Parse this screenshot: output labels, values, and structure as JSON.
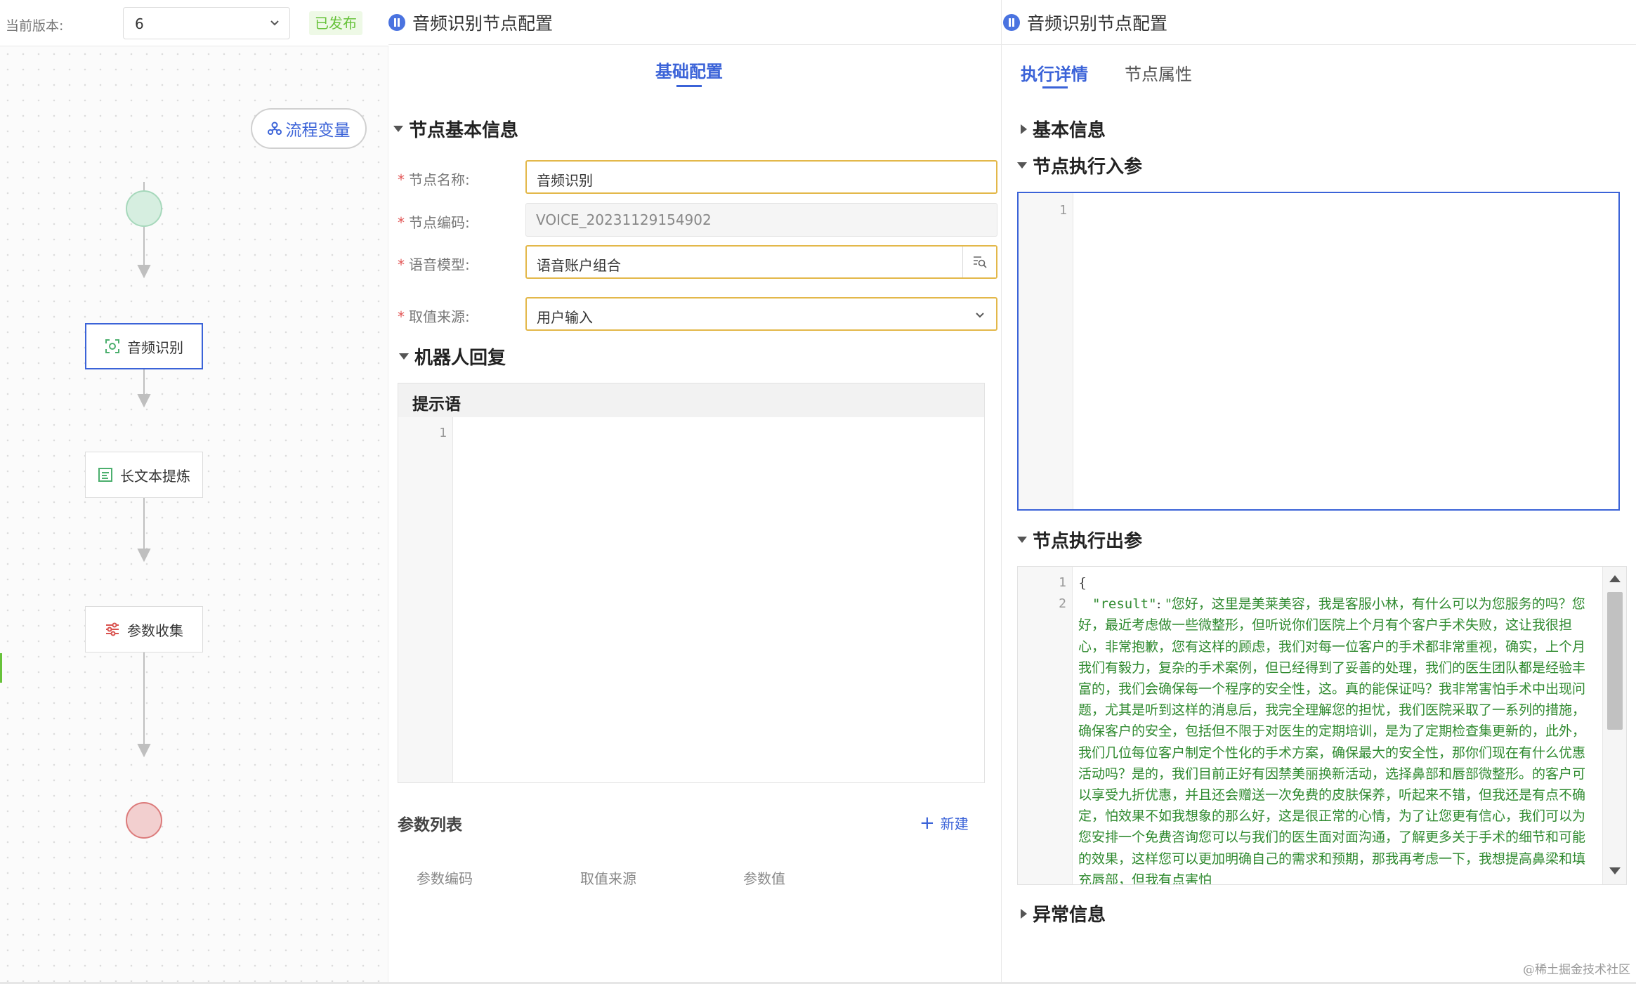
{
  "version_bar": {
    "label": "当前版本:",
    "selected_version": "6",
    "status_badge": "已发布"
  },
  "flow": {
    "flow_variables_button": "流程变量",
    "nodes": {
      "audio_recognition": "音频识别",
      "long_text_extraction": "长文本提炼",
      "parameter_collection": "参数收集"
    }
  },
  "config_panel": {
    "title": "音频识别节点配置",
    "tab": "基础配置",
    "section_basic": "节点基本信息",
    "fields": {
      "node_name": {
        "label": "节点名称:",
        "value": "音频识别"
      },
      "node_code": {
        "label": "节点编码:",
        "value": "VOICE_20231129154902"
      },
      "voice_model": {
        "label": "语音模型:",
        "value": "语音账户组合"
      },
      "value_source": {
        "label": "取值来源:",
        "value": "用户输入"
      }
    },
    "section_robot_reply": "机器人回复",
    "prompt": {
      "title": "提示语",
      "line_number": "1"
    },
    "param_list": {
      "title": "参数列表",
      "new_button": "新建",
      "columns": [
        "参数编码",
        "取值来源",
        "参数值"
      ]
    }
  },
  "exec_panel": {
    "title": "音频识别节点配置",
    "tabs": {
      "exec_detail": "执行详情",
      "node_props": "节点属性"
    },
    "sections": {
      "basic_info": "基本信息",
      "exec_input": "节点执行入参",
      "exec_output": "节点执行出参",
      "error_info": "异常信息"
    },
    "input_editor": {
      "line_number": "1"
    },
    "output_editor": {
      "line_numbers": [
        "1",
        "2"
      ],
      "open_brace": "{",
      "key": "\"result\"",
      "colon": ": ",
      "text": "\"您好，这里是美莱美容，我是客服小林，有什么可以为您服务的吗？您好，最近考虑做一些微整形，但听说你们医院上个月有个客户手术失败，这让我很担心，非常抱歉，您有这样的顾虑，我们对每一位客户的手术都非常重视，确实，上个月我们有毅力，复杂的手术案例，但已经得到了妥善的处理，我们的医生团队都是经验丰富的，我们会确保每一个程序的安全性，这。真的能保证吗？我非常害怕手术中出现问题，尤其是听到这样的消息后，我完全理解您的担忧，我们医院采取了一系列的措施，确保客户的安全，包括但不限于对医生的定期培训，是为了定期检查集更新的，此外，我们几位每位客户制定个性化的手术方案，确保最大的安全性，那你们现在有什么优惠活动吗？是的，我们目前正好有因禁美丽换新活动，选择鼻部和唇部微整形。的客户可以享受九折优惠，并且还会赠送一次免费的皮肤保养，听起来不错，但我还是有点不确定，怕效果不如我想象的那么好，这是很正常的心情，为了让您更有信心，我们可以为您安排一个免费咨询您可以与我们的医生面对面沟通，了解更多关于手术的细节和可能的效果，这样您可以更加明确自己的需求和预期，那我再考虑一下，我想提高鼻梁和填充唇部，但我有点害怕"
    }
  },
  "watermark": "@稀土掘金技术社区",
  "colors": {
    "accent": "#3b63d8",
    "published_green": "#67c23a",
    "required_red": "#e25555",
    "input_highlight": "#e3b84a",
    "json_string_green": "#2f8a2f"
  }
}
